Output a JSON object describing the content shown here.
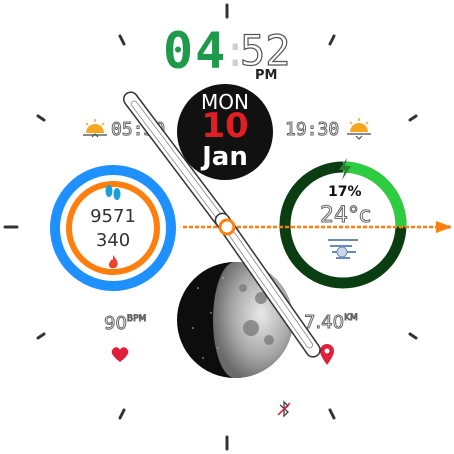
{
  "time": {
    "hour": "04",
    "separator": ":",
    "minute": "52",
    "ampm": "PM"
  },
  "date": {
    "weekday": "MON",
    "day": "10",
    "month": "Jan"
  },
  "sun": {
    "sunrise": "05:30",
    "sunset": "19:30"
  },
  "activity": {
    "steps": "9571",
    "calories": "340"
  },
  "battery": {
    "percent": "17%",
    "level": 0.17
  },
  "weather": {
    "temperature": "24°c"
  },
  "heart": {
    "value": "90",
    "unit": "BPM"
  },
  "distance": {
    "value": "7.40",
    "unit": "KM"
  },
  "colors": {
    "hour": "#1e9a4a",
    "day": "#e01e25",
    "activity_outer": "#1e90ff",
    "activity_inner": "#ff7f0e",
    "battery": "#2ecc40",
    "battery_track": "#0b3d12",
    "hand": "#ff7f0e",
    "heart": "#e0203a"
  }
}
